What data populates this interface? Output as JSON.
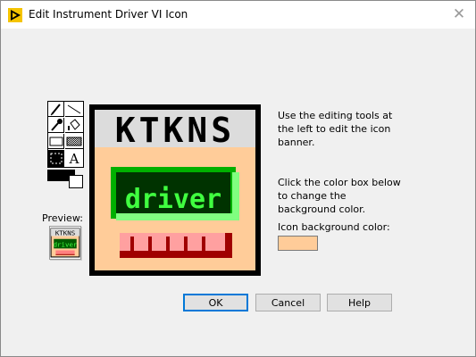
{
  "window": {
    "title": "Edit Instrument Driver VI Icon"
  },
  "icon": {
    "banner_text": "KTKNS",
    "body_text": "driver",
    "background_color": "#ffcc99"
  },
  "preview": {
    "label": "Preview:"
  },
  "help": {
    "banner_help": "Use the editing tools at the left to edit the icon banner.",
    "color_help": "Click the color box below to change the background color.",
    "bg_color_label": "Icon background color:"
  },
  "buttons": {
    "ok": "OK",
    "cancel": "Cancel",
    "help": "Help"
  },
  "tools": [
    "pencil-icon",
    "line-icon",
    "dropper-icon",
    "fill-icon",
    "rectangle-icon",
    "filled-rectangle-icon",
    "select-icon",
    "text-icon"
  ],
  "tool_glyph": {
    "text": "A"
  }
}
